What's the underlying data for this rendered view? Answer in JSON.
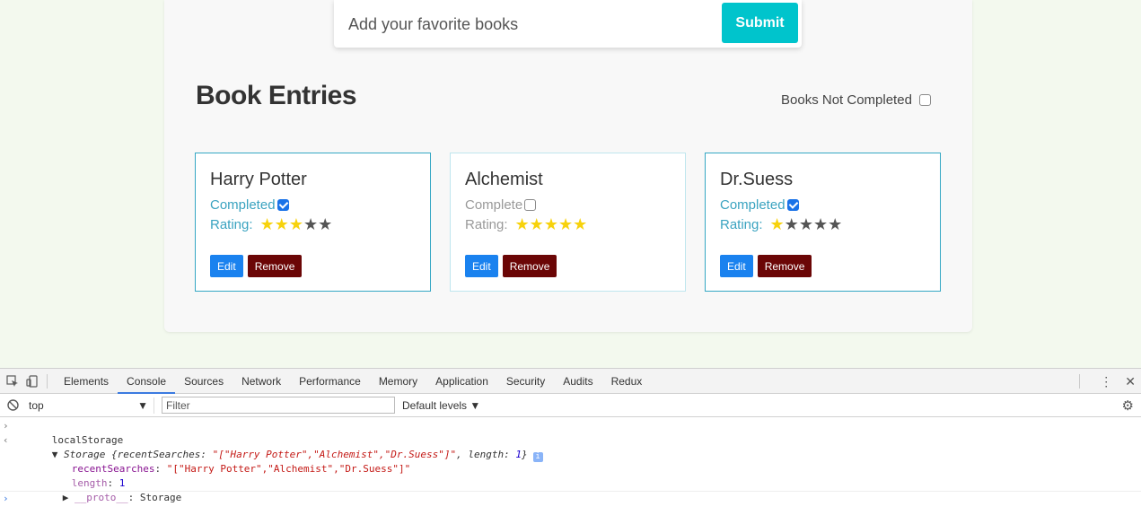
{
  "app": {
    "search": {
      "placeholder": "Add your favorite books",
      "submit_label": "Submit"
    },
    "title": "Book Entries",
    "filter_label": "Books Not Completed",
    "filter_checked": false,
    "cards": [
      {
        "title": "Harry Potter",
        "status_label": "Completed",
        "completed": true,
        "rating_label": "Rating:",
        "rating": 3,
        "max_rating": 5,
        "edit_label": "Edit",
        "remove_label": "Remove"
      },
      {
        "title": "Alchemist",
        "status_label": "Complete",
        "completed": false,
        "rating_label": "Rating:",
        "rating": 5,
        "max_rating": 5,
        "edit_label": "Edit",
        "remove_label": "Remove"
      },
      {
        "title": "Dr.Suess",
        "status_label": "Completed",
        "completed": true,
        "rating_label": "Rating:",
        "rating": 1,
        "max_rating": 5,
        "edit_label": "Edit",
        "remove_label": "Remove"
      }
    ],
    "colors": {
      "accent": "#00c4cc",
      "star_on": "#f7d20c",
      "star_off": "#555555",
      "edit": "#1a82ef",
      "remove": "#6b0606",
      "card_border": "#35a7c4"
    }
  },
  "devtools": {
    "tabs": [
      "Elements",
      "Console",
      "Sources",
      "Network",
      "Performance",
      "Memory",
      "Application",
      "Security",
      "Audits",
      "Redux"
    ],
    "active_tab": "Console",
    "context": "top",
    "filter_placeholder": "Filter",
    "levels_label": "Default levels ▼",
    "console": {
      "input": "localStorage",
      "result_prefix": "Storage {",
      "result_key1": "recentSearches",
      "result_val1": "\"[\"Harry Potter\",\"Alchemist\",\"Dr.Suess\"]\"",
      "result_key2": "length",
      "result_val2": "1",
      "result_suffix": "}",
      "prop1_key": "recentSearches",
      "prop1_val": "\"[\"Harry Potter\",\"Alchemist\",\"Dr.Suess\"]\"",
      "prop2_key": "length",
      "prop2_val": "1",
      "proto_key": "__proto__",
      "proto_val": "Storage"
    }
  }
}
